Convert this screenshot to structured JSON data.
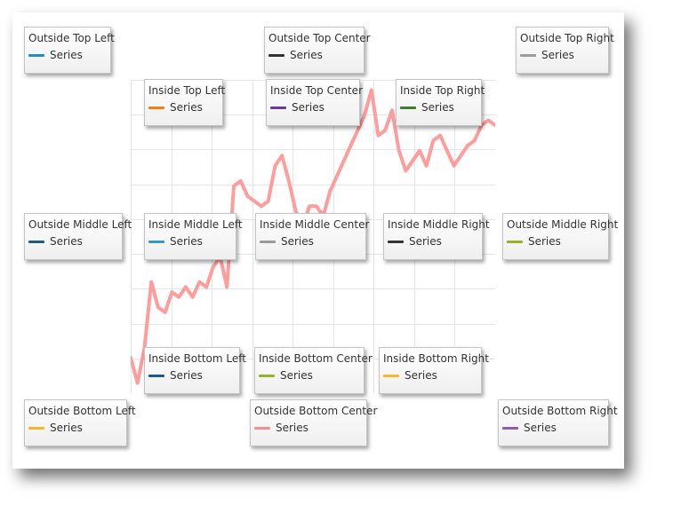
{
  "chart_data": {
    "type": "line",
    "title": "",
    "xlabel": "",
    "ylabel": "",
    "grid": true,
    "series": [
      {
        "color": "#ff9c9c",
        "values": [
          45,
          40,
          47,
          60,
          55,
          54,
          58,
          57,
          59,
          57,
          60,
          59,
          63,
          65,
          59,
          79,
          80,
          77,
          76,
          75,
          76,
          83,
          85,
          80,
          74,
          71,
          75,
          75,
          73,
          78,
          81,
          84,
          87,
          90,
          93,
          98,
          89,
          90,
          94,
          86,
          82,
          84,
          86,
          83,
          88,
          89,
          86,
          83,
          85,
          87,
          88,
          91,
          92,
          91
        ]
      }
    ],
    "ylim": [
      38,
      100
    ]
  },
  "legends": [
    {
      "title": "Outside Top Left",
      "series": "Series",
      "color": "#1f8ec8"
    },
    {
      "title": "Outside Top Center",
      "series": "Series",
      "color": "#333333"
    },
    {
      "title": "Outside Top Right",
      "series": "Series",
      "color": "#9a9a9a"
    },
    {
      "title": "Inside Top Left",
      "series": "Series",
      "color": "#f57f17"
    },
    {
      "title": "Inside Top Center",
      "series": "Series",
      "color": "#6a3aa2"
    },
    {
      "title": "Inside Top Right",
      "series": "Series",
      "color": "#3f7c32"
    },
    {
      "title": "Outside Middle Left",
      "series": "Series",
      "color": "#1d5a86"
    },
    {
      "title": "Inside Middle Left",
      "series": "Series",
      "color": "#2e9ad0"
    },
    {
      "title": "Inside Middle Center",
      "series": "Series",
      "color": "#9a9a9a"
    },
    {
      "title": "Inside Middle Right",
      "series": "Series",
      "color": "#333333"
    },
    {
      "title": "Outside Middle Right",
      "series": "Series",
      "color": "#95b22c"
    },
    {
      "title": "Inside Bottom Left",
      "series": "Series",
      "color": "#1d5a86"
    },
    {
      "title": "Inside Bottom Center",
      "series": "Series",
      "color": "#95b22c"
    },
    {
      "title": "Inside Bottom Right",
      "series": "Series",
      "color": "#f9b42c"
    },
    {
      "title": "Outside Bottom Left",
      "series": "Series",
      "color": "#f9b42c"
    },
    {
      "title": "Outside Bottom Center",
      "series": "Series",
      "color": "#ff8a8a"
    },
    {
      "title": "Outside Bottom Right",
      "series": "Series",
      "color": "#8e5ab5"
    }
  ]
}
